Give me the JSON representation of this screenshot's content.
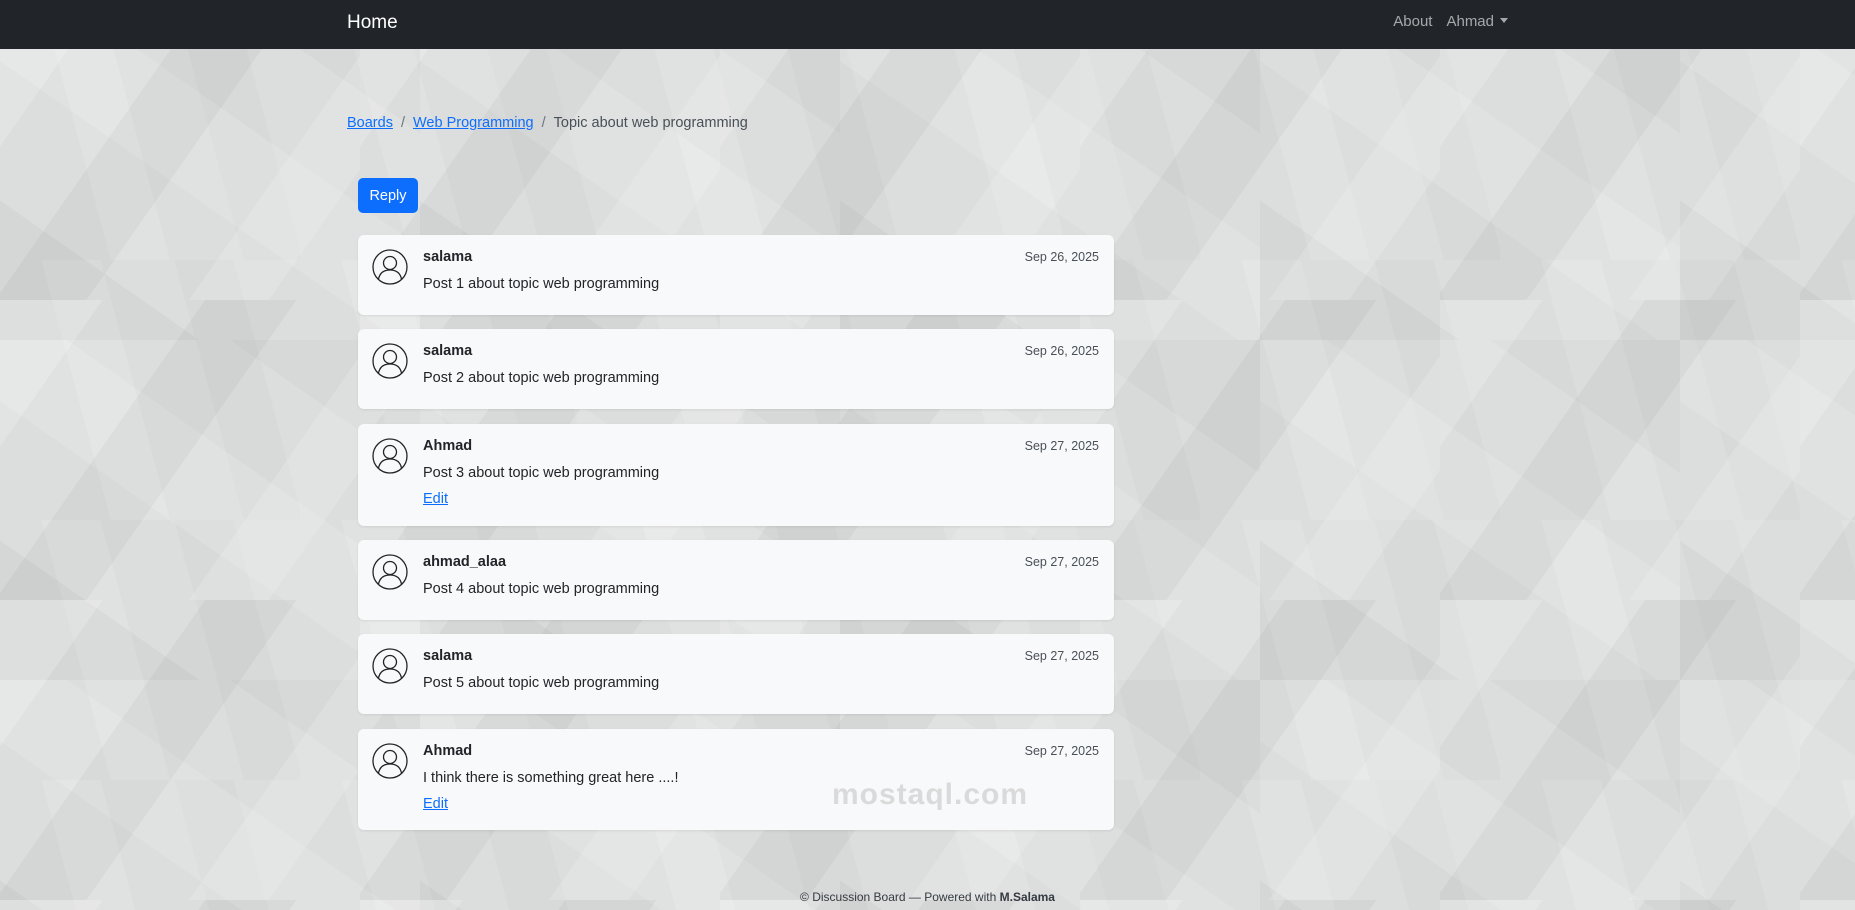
{
  "navbar": {
    "brand": "Home",
    "about": "About",
    "user": "Ahmad"
  },
  "breadcrumb": {
    "boards": "Boards",
    "board": "Web Programming",
    "topic": "Topic about web programming"
  },
  "reply_label": "Reply",
  "posts": [
    {
      "author": "salama",
      "date": "Sep 26, 2025",
      "message": "Post 1 about topic web programming"
    },
    {
      "author": "salama",
      "date": "Sep 26, 2025",
      "message": "Post 2 about topic web programming"
    },
    {
      "author": "Ahmad",
      "date": "Sep 27, 2025",
      "message": "Post 3 about topic web programming",
      "edit": "Edit"
    },
    {
      "author": "ahmad_alaa",
      "date": "Sep 27, 2025",
      "message": "Post 4 about topic web programming"
    },
    {
      "author": "salama",
      "date": "Sep 27, 2025",
      "message": "Post 5 about topic web programming"
    },
    {
      "author": "Ahmad",
      "date": "Sep 27, 2025",
      "message": "I think there is something great here ....!",
      "edit": "Edit"
    }
  ],
  "footer": {
    "text": "© Discussion Board — Powered with",
    "author": "M.Salama"
  },
  "watermark": "mostaql.com",
  "colors": {
    "navbar": "#212529",
    "primary": "#0d6efd",
    "card": "#f8f9fa"
  }
}
